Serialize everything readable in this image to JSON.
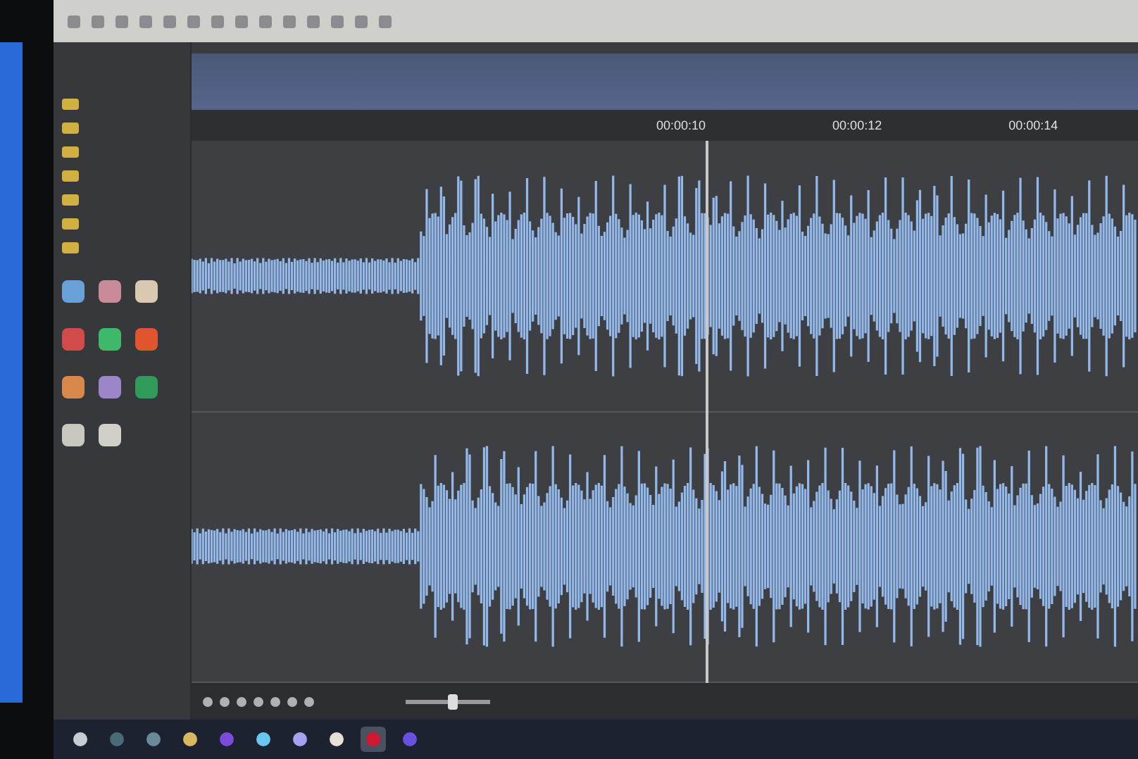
{
  "ruler": {
    "labels": [
      "00:00:10",
      "00:00:12",
      "00:00:14"
    ]
  },
  "zoom": {
    "level": 0.55
  },
  "sidebar": {
    "apps": [
      {
        "color": "#6aa0d8"
      },
      {
        "color": "#c98a9a"
      },
      {
        "color": "#d9c9b0"
      },
      {
        "color": "#d24a4a"
      },
      {
        "color": "#3fb86a"
      },
      {
        "color": "#e0552e"
      },
      {
        "color": "#d8884a"
      },
      {
        "color": "#9a86c8"
      },
      {
        "color": "#2f9a5a"
      },
      {
        "color": "#c8c8c0"
      },
      {
        "color": "#d0d0c8"
      }
    ]
  },
  "taskbar": [
    {
      "color": "#c8ccd4",
      "selected": false
    },
    {
      "color": "#4a6a7a",
      "selected": false
    },
    {
      "color": "#6a8a9a",
      "selected": false
    },
    {
      "color": "#d8b860",
      "selected": false
    },
    {
      "color": "#7a4ad8",
      "selected": false
    },
    {
      "color": "#6ac8f0",
      "selected": false
    },
    {
      "color": "#a8a0f0",
      "selected": false
    },
    {
      "color": "#e8e0d8",
      "selected": false
    },
    {
      "color": "#d01830",
      "selected": true
    },
    {
      "color": "#6a50e0",
      "selected": false
    }
  ]
}
